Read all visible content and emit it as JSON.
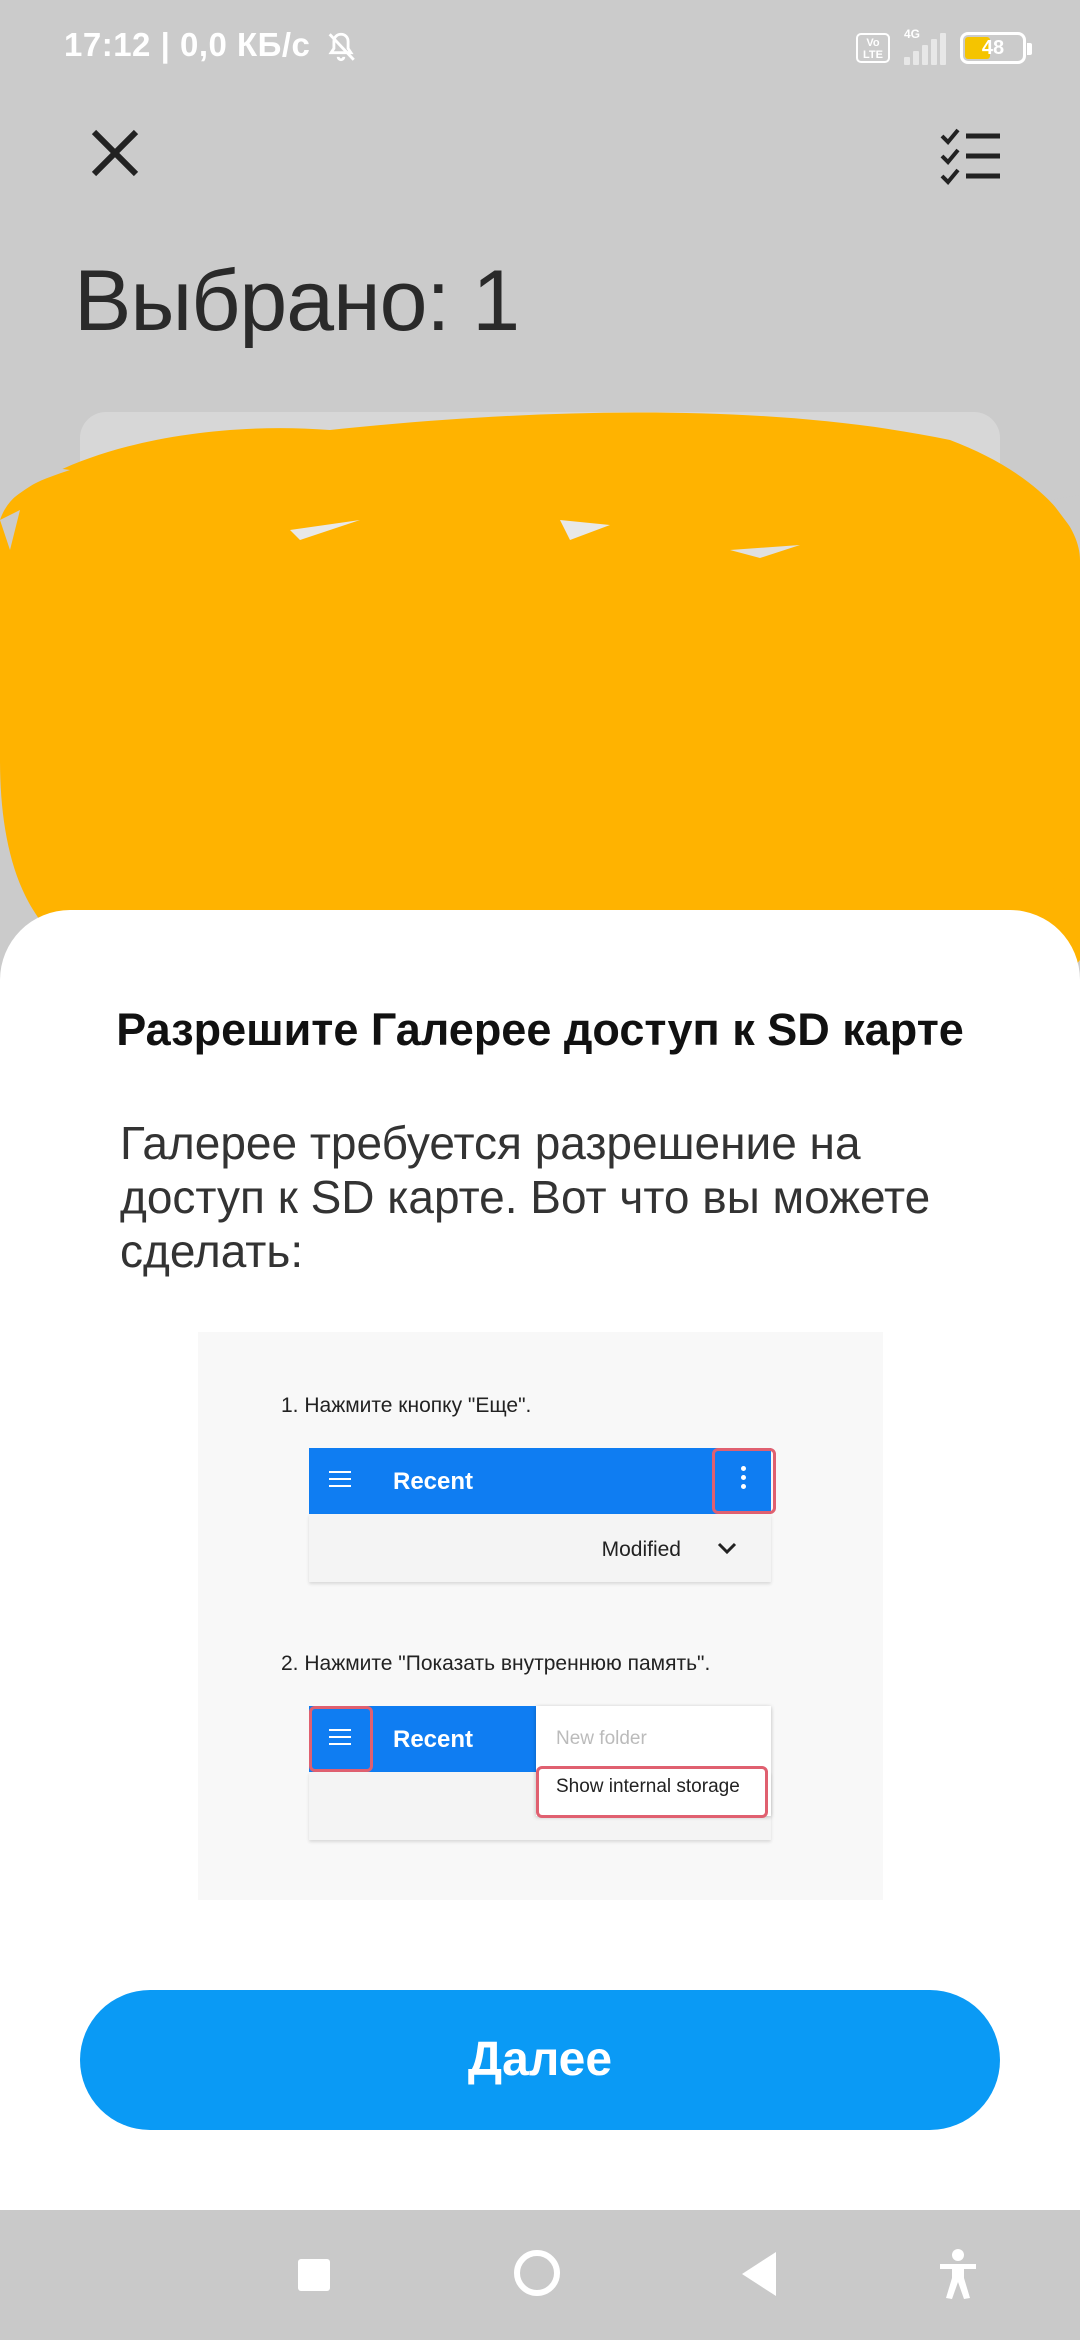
{
  "status_bar": {
    "time_and_speed": "17:12 | 0,0 КБ/с",
    "network_type": "4G",
    "volte_label": "Vo LTE",
    "battery_level": "48"
  },
  "header": {
    "title": "Выбрано: 1"
  },
  "sheet": {
    "title": "Разрешите Галерее доступ к SD карте",
    "description": "Галерее требуется разрешение на доступ к SD карте. Вот что вы можете сделать:",
    "step1": "1. Нажмите кнопку \"Еще\".",
    "step2": "2. Нажмите \"Показать внутреннюю память\".",
    "mock_title": "Recent",
    "mock_modified": "Modified",
    "mock_new_folder": "New folder",
    "mock_show_internal": "Show internal storage",
    "next_button": "Далее"
  },
  "colors": {
    "accent": "#0a9af5",
    "redaction": "#ffb300",
    "mock_bar": "#0f7df2",
    "highlight": "#e06070"
  },
  "icons": {
    "close": "close-icon",
    "select_all": "checklist-icon",
    "nav_recents": "square-icon",
    "nav_home": "circle-icon",
    "nav_back": "triangle-back-icon",
    "accessibility": "accessibility-icon"
  }
}
